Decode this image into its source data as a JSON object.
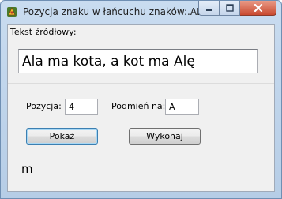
{
  "window": {
    "title": "Pozycja znaku w łańcuchu znaków:.AL",
    "icon": "app-icon",
    "minimize_icon": "minimize-icon",
    "maximize_icon": "maximize-icon",
    "close_icon": "close-icon"
  },
  "source": {
    "label": "Tekst źródłowy:",
    "value": "Ala ma kota, a kot ma Alę"
  },
  "position": {
    "label": "Pozycja:",
    "value": "4"
  },
  "replace": {
    "label": "Podmień na:",
    "value": "A"
  },
  "buttons": {
    "show": "Pokaż",
    "execute": "Wykonaj"
  },
  "result": {
    "text": "m"
  }
}
